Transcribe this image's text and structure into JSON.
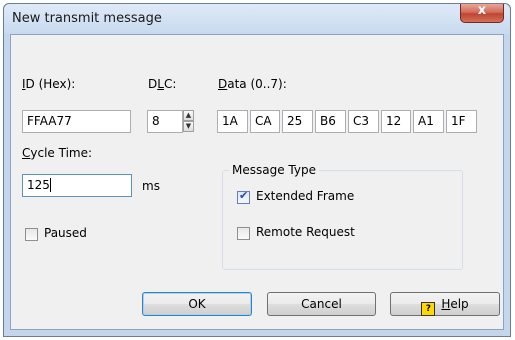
{
  "window": {
    "title": "New transmit message",
    "close_glyph": "x"
  },
  "id": {
    "label_accel": "I",
    "label_rest": "D (Hex):",
    "value": "FFAA77"
  },
  "dlc": {
    "label_pre": "D",
    "label_accel": "L",
    "label_rest": "C:",
    "value": "8"
  },
  "data": {
    "label_accel": "D",
    "label_rest": "ata (0..7):",
    "bytes": [
      "1A",
      "CA",
      "25",
      "B6",
      "C3",
      "12",
      "A1",
      "1F"
    ]
  },
  "cycle": {
    "label_accel": "C",
    "label_rest": "ycle Time:",
    "value": "125",
    "unit": "ms"
  },
  "paused": {
    "label": "Paused",
    "checked": false
  },
  "message_type": {
    "title": "Message Type",
    "extended": {
      "label": "Extended Frame",
      "checked": true
    },
    "remote": {
      "label": "Remote Request",
      "checked": false
    }
  },
  "buttons": {
    "ok": "OK",
    "cancel": "Cancel",
    "help_accel": "H",
    "help_rest": "elp",
    "help_icon": "help-icon"
  }
}
